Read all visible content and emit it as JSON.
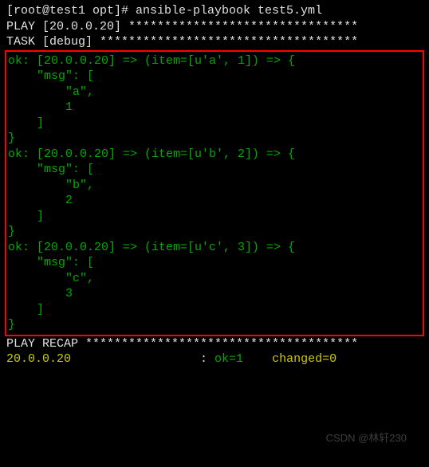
{
  "prompt": "[root@test1 opt]# ansible-playbook test5.yml",
  "blank": "",
  "play_header": "PLAY [20.0.0.20] ********************************",
  "task_header": "TASK [debug] ************************************",
  "output": {
    "item1": {
      "l1": "ok: [20.0.0.20] => (item=[u'a', 1]) => {",
      "l2": "    \"msg\": [",
      "l3": "        \"a\",",
      "l4": "        1",
      "l5": "    ]",
      "l6": "}"
    },
    "item2": {
      "l1": "ok: [20.0.0.20] => (item=[u'b', 2]) => {",
      "l2": "    \"msg\": [",
      "l3": "        \"b\",",
      "l4": "        2",
      "l5": "    ]",
      "l6": "}"
    },
    "item3": {
      "l1": "ok: [20.0.0.20] => (item=[u'c', 3]) => {",
      "l2": "    \"msg\": [",
      "l3": "        \"c\",",
      "l4": "        3",
      "l5": "    ]",
      "l6": "}"
    }
  },
  "recap_header": "PLAY RECAP **************************************",
  "recap_host": "20.0.0.20",
  "recap_spacer": "                  : ",
  "recap_ok": "ok=1   ",
  "recap_changed": " changed=0 ",
  "watermark": "CSDN @林轩230"
}
